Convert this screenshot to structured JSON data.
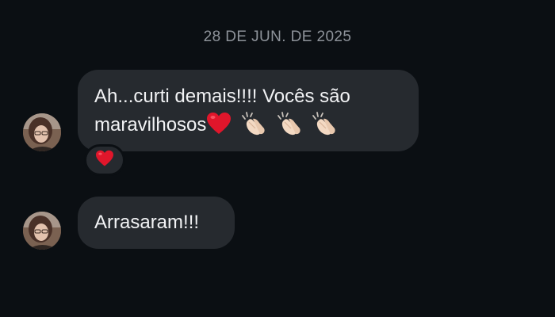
{
  "conversation": {
    "date_separator": "28 DE JUN. DE 2025",
    "messages": [
      {
        "line1": "Ah...curti demais!!!! Vocês são",
        "line2": "maravilhosos",
        "emojis": [
          "red-heart",
          "clapping-hands",
          "clapping-hands",
          "clapping-hands"
        ],
        "reaction": "red-heart"
      },
      {
        "text": "Arrasaram!!!"
      }
    ]
  },
  "colors": {
    "background": "#0b0f13",
    "bubble": "#262a2f",
    "text": "#f2f3f5",
    "date_text": "#8e939a",
    "heart": "#e0162b"
  }
}
